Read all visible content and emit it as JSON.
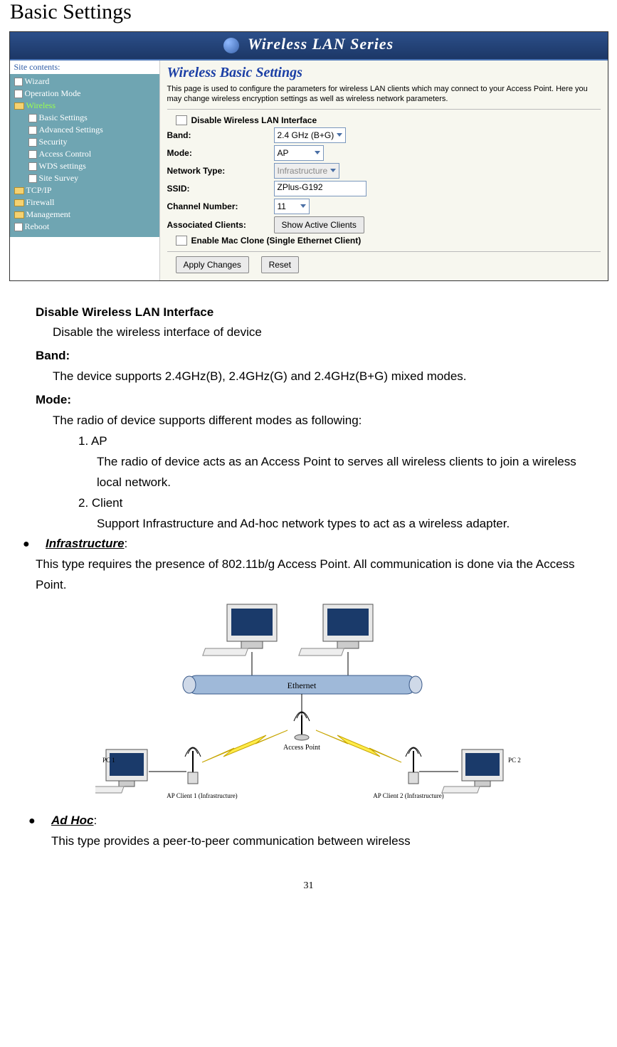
{
  "title": "Basic Settings",
  "page_number": "31",
  "screenshot": {
    "banner": "Wireless LAN Series",
    "site_contents_label": "Site contents:",
    "tree": {
      "wizard": "Wizard",
      "op_mode": "Operation Mode",
      "wireless": "Wireless",
      "basic": "Basic Settings",
      "advanced": "Advanced Settings",
      "security": "Security",
      "access_ctrl": "Access Control",
      "wds": "WDS settings",
      "survey": "Site Survey",
      "tcpip": "TCP/IP",
      "firewall": "Firewall",
      "management": "Management",
      "reboot": "Reboot"
    },
    "main": {
      "heading": "Wireless Basic Settings",
      "desc": "This page is used to configure the parameters for wireless LAN clients which may connect to your Access Point. Here you may change wireless encryption settings as well as wireless network parameters.",
      "disable_label": "Disable Wireless LAN Interface",
      "fields": {
        "band_label": "Band:",
        "band_value": "2.4 GHz (B+G)",
        "mode_label": "Mode:",
        "mode_value": "AP",
        "nettype_label": "Network Type:",
        "nettype_value": "Infrastructure",
        "ssid_label": "SSID:",
        "ssid_value": "ZPlus-G192",
        "channel_label": "Channel Number:",
        "channel_value": "11",
        "assoc_label": "Associated Clients:",
        "assoc_btn": "Show Active Clients",
        "mac_clone_label": "Enable Mac Clone (Single Ethernet Client)"
      },
      "buttons": {
        "apply": "Apply Changes",
        "reset": "Reset"
      }
    }
  },
  "body": {
    "disable_h": "Disable Wireless LAN Interface",
    "disable_p": "Disable the wireless interface of device",
    "band_h": "Band:",
    "band_p": "The device supports 2.4GHz(B), 2.4GHz(G) and 2.4GHz(B+G) mixed modes.",
    "mode_h": "Mode:",
    "mode_p": "The radio of device supports different modes as following:",
    "mode_1": "1. AP",
    "mode_1_p": "The radio of device acts as an Access Point to serves all wireless clients to join a wireless local network.",
    "mode_2": "2. Client",
    "mode_2_p": "Support Infrastructure and Ad-hoc network types to act as a wireless adapter.",
    "infra_h": "Infrastructure",
    "infra_p": "This type requires the presence of 802.11b/g Access Point. All communication is done via the Access Point."
  },
  "diagram": {
    "ethernet": "Ethernet",
    "ap": "Access Point",
    "pc1": "PC 1",
    "pc2": "PC 2",
    "apc1": "AP Client 1 (Infrastructure)",
    "apc2": "AP Client 2 (Infrastructure)"
  },
  "adhoc": {
    "h": "Ad Hoc",
    "p": "This type provides a peer-to-peer communication between wireless"
  }
}
